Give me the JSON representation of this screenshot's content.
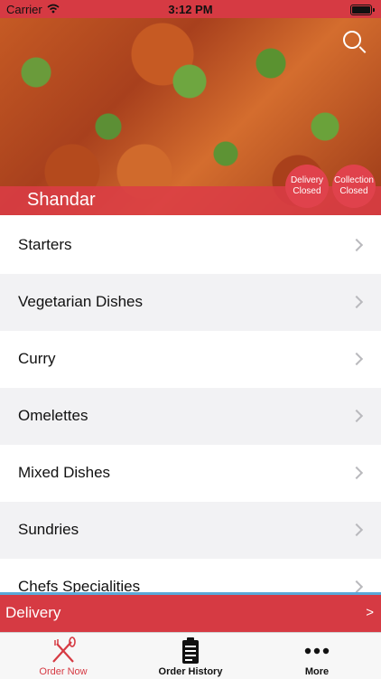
{
  "status_bar": {
    "carrier": "Carrier",
    "time": "3:12 PM"
  },
  "header": {
    "restaurant_name": "Shandar"
  },
  "badges": {
    "delivery": "Delivery Closed",
    "collection": "Collection Closed"
  },
  "menu": {
    "items": [
      {
        "label": "Starters"
      },
      {
        "label": "Vegetarian Dishes"
      },
      {
        "label": "Curry"
      },
      {
        "label": "Omelettes"
      },
      {
        "label": "Mixed Dishes"
      },
      {
        "label": "Sundries"
      },
      {
        "label": "Chefs Specialities"
      }
    ]
  },
  "delivery_bar": {
    "label": "Delivery",
    "arrow": ">"
  },
  "tabs": [
    {
      "label": "Order Now",
      "icon": "fork-knife-icon",
      "active": true
    },
    {
      "label": "Order History",
      "icon": "clipboard-icon",
      "active": false
    },
    {
      "label": "More",
      "icon": "more-dots-icon",
      "active": false
    }
  ],
  "colors": {
    "accent": "#d63a43",
    "divider": "#5aa8d8"
  }
}
